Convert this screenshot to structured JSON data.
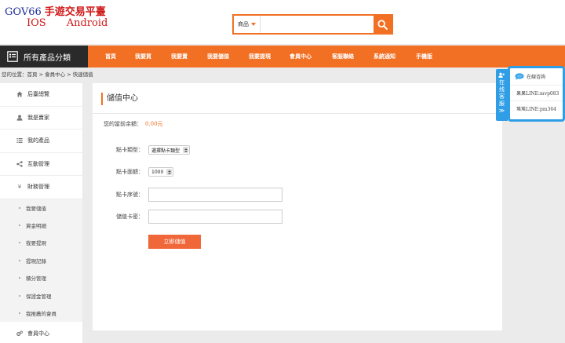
{
  "logo": {
    "brand": "GOV66",
    "tagline": "手遊交易平臺",
    "platform_ios": "IOS",
    "platform_android": "Android"
  },
  "search": {
    "type_label": "商品",
    "value": "",
    "placeholder": ""
  },
  "nav": {
    "category_label": "所有產品分類",
    "items": [
      "首頁",
      "我要買",
      "我要賣",
      "我要儲值",
      "我要提現",
      "會員中心",
      "客服聯絡",
      "系統通知",
      "手機版"
    ]
  },
  "breadcrumb": "您的位置：首頁 > 會員中心 > 快速儲值",
  "sidebar": {
    "items": [
      {
        "label": "后臺總覽",
        "icon": "home-icon"
      },
      {
        "label": "我是賣家",
        "icon": "user-icon"
      },
      {
        "label": "我的產品",
        "icon": "list-icon"
      },
      {
        "label": "互動管理",
        "icon": "share-icon"
      },
      {
        "label": "財務管理",
        "icon": "yen-icon"
      }
    ],
    "sub_items": [
      "我要儲值",
      "資金明細",
      "我要提現",
      "提現記錄",
      "積分管理",
      "保證金管理",
      "我推薦的會員"
    ],
    "bottom_item": {
      "label": "會員中心",
      "icon": "gears-icon"
    }
  },
  "panel": {
    "title": "儲值中心",
    "balance_label": "您的當前余額：",
    "balance_value": "0.00元",
    "card_type_label": "點卡類型：",
    "card_type_value": "選擇點卡類型",
    "card_value_label": "點卡面額：",
    "card_value_value": "1000",
    "card_serial_label": "點卡序號：",
    "card_serial_value": "",
    "card_password_label": "儲值卡密：",
    "card_password_value": "",
    "submit_label": "立即儲值"
  },
  "customer_service": {
    "tab_chars": [
      "在",
      "线",
      "客",
      "服"
    ],
    "tab_arrow": "≫",
    "online_label": "在線咨詢",
    "line1": "果果LINE:mvp083",
    "line2": "瑤瑤LINE:pm364"
  },
  "colors": {
    "accent": "#f27023",
    "dark": "#2a2a2a",
    "cs_blue": "#2f9ee6"
  }
}
